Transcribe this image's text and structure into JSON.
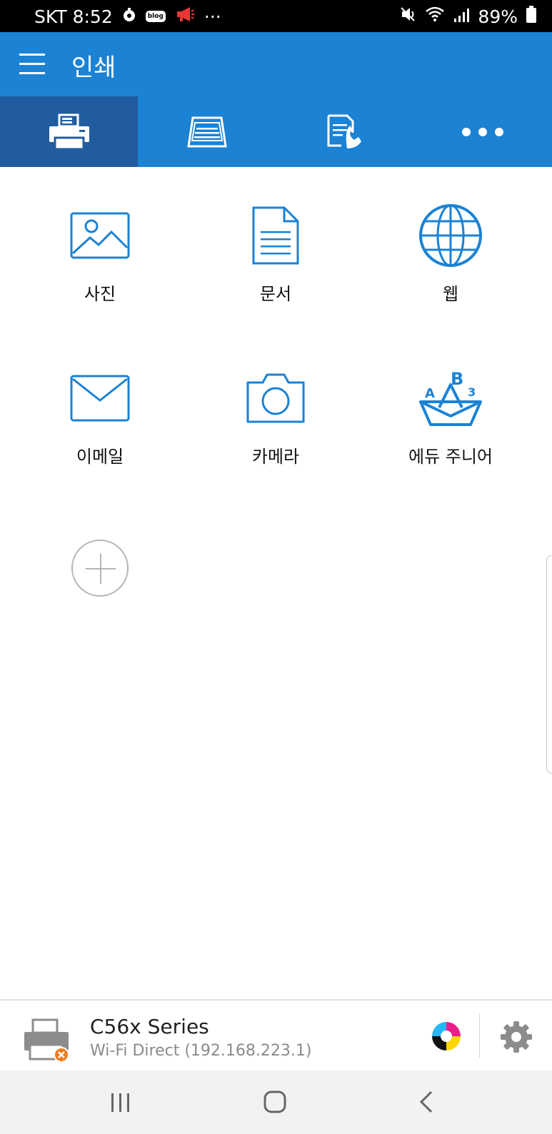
{
  "status_bar": {
    "carrier": "SKT",
    "time": "8:52",
    "blog_badge": "blog",
    "more": "···",
    "battery": "89%"
  },
  "app_bar": {
    "title": "인쇄"
  },
  "tabs": [
    {
      "name": "print",
      "icon": "printer-icon",
      "active": true
    },
    {
      "name": "scan",
      "icon": "scanner-icon",
      "active": false
    },
    {
      "name": "fax",
      "icon": "fax-icon",
      "active": false
    },
    {
      "name": "more",
      "icon": "more-icon",
      "active": false
    }
  ],
  "grid": [
    {
      "label": "사진",
      "icon": "photo-icon"
    },
    {
      "label": "문서",
      "icon": "document-icon"
    },
    {
      "label": "웹",
      "icon": "globe-icon"
    },
    {
      "label": "이메일",
      "icon": "email-icon"
    },
    {
      "label": "카메라",
      "icon": "camera-icon"
    },
    {
      "label": "에듀 주니어",
      "icon": "edu-junior-icon",
      "icon_letters": [
        "A",
        "B",
        "3"
      ]
    }
  ],
  "printer": {
    "name": "C56x Series",
    "connection": "Wi-Fi Direct (192.168.223.1)"
  },
  "colors": {
    "accent": "#1b82d4",
    "active_tab": "#215c9f",
    "icon_blue": "#1b82d4",
    "error_badge": "#f07c1e"
  }
}
